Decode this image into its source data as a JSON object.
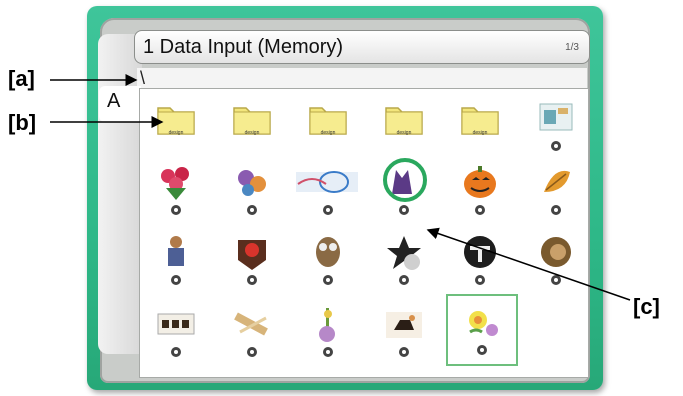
{
  "screen": {
    "title": "1 Data Input (Memory)",
    "page_indicator": "1/3",
    "path": "\\",
    "drive": "A"
  },
  "folders": [
    {
      "label": "design"
    },
    {
      "label": "design"
    },
    {
      "label": "design"
    },
    {
      "label": "design"
    },
    {
      "label": "design"
    }
  ],
  "callouts": {
    "a": "[a]",
    "b": "[b]",
    "c": "[c]"
  },
  "colors": {
    "frame": "#2eb888",
    "selection": "#6dbf7d",
    "highlight": "#2aa85e",
    "folder": "#f0e27a"
  }
}
